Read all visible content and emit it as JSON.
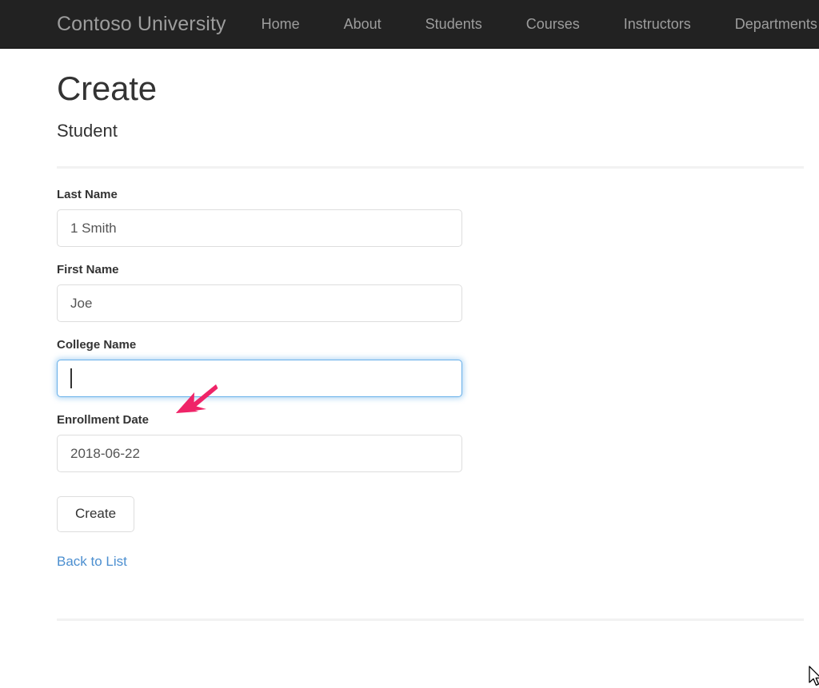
{
  "navbar": {
    "brand": "Contoso University",
    "links": [
      {
        "label": "Home",
        "name": "nav-link-home"
      },
      {
        "label": "About",
        "name": "nav-link-about"
      },
      {
        "label": "Students",
        "name": "nav-link-students"
      },
      {
        "label": "Courses",
        "name": "nav-link-courses"
      },
      {
        "label": "Instructors",
        "name": "nav-link-instructors"
      },
      {
        "label": "Departments",
        "name": "nav-link-departments"
      }
    ],
    "background_color": "#222222",
    "link_color": "#9d9d9d"
  },
  "page": {
    "title": "Create",
    "subtitle": "Student"
  },
  "form": {
    "fields": [
      {
        "label": "Last Name",
        "value": "1 Smith",
        "placeholder": "",
        "focused": false
      },
      {
        "label": "First Name",
        "value": "Joe",
        "placeholder": "",
        "focused": false
      },
      {
        "label": "College Name",
        "value": "",
        "placeholder": "",
        "focused": true
      },
      {
        "label": "Enrollment Date",
        "value": "2018-06-22",
        "placeholder": "",
        "focused": false
      }
    ],
    "submit_label": "Create",
    "back_link_label": "Back to List",
    "back_link_color": "#4c8fd0",
    "focus_border_color": "#66afe9"
  },
  "annotation": {
    "arrow_color": "#ef2468",
    "points_to": "College Name"
  }
}
